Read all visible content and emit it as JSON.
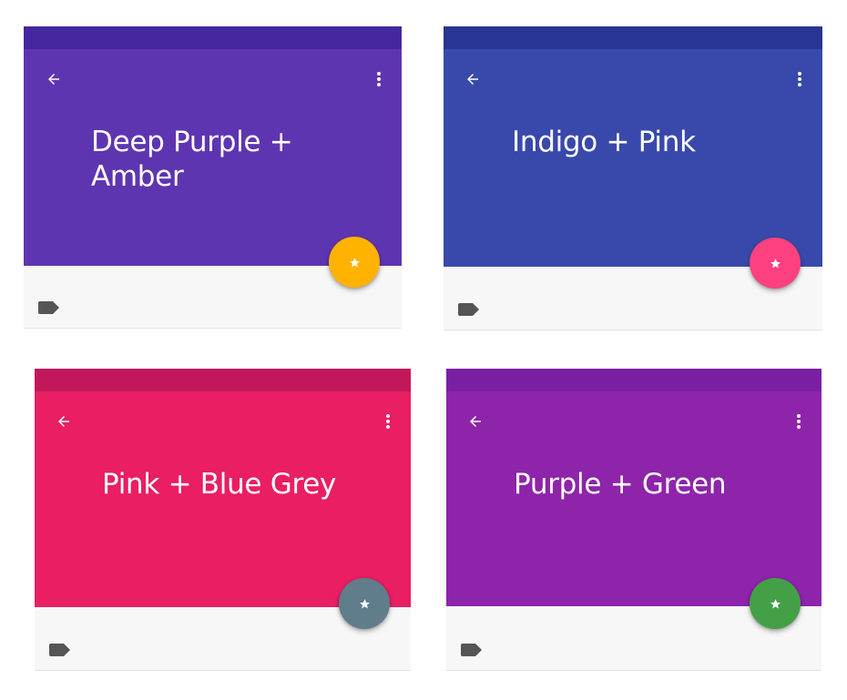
{
  "cards": [
    {
      "title": "Deep Purple +\nAmber",
      "primary_dark": "#4527a0",
      "primary": "#5e35b1",
      "accent": "#ffb300",
      "icons": {
        "back": "arrow-back-icon",
        "more": "more-vert-icon",
        "fab": "star-icon",
        "label": "label-tag-icon"
      }
    },
    {
      "title": "Indigo + Pink",
      "primary_dark": "#283593",
      "primary": "#3949ab",
      "accent": "#ff4081",
      "icons": {
        "back": "arrow-back-icon",
        "more": "more-vert-icon",
        "fab": "star-icon",
        "label": "label-tag-icon"
      }
    },
    {
      "title": "Pink + Blue Grey",
      "primary_dark": "#c2185b",
      "primary": "#e91e63",
      "accent": "#607d8b",
      "icons": {
        "back": "arrow-back-icon",
        "more": "more-vert-icon",
        "fab": "star-icon",
        "label": "label-tag-icon"
      }
    },
    {
      "title": "Purple + Green",
      "primary_dark": "#7b1fa2",
      "primary": "#8e24aa",
      "accent": "#43a047",
      "icons": {
        "back": "arrow-back-icon",
        "more": "more-vert-icon",
        "fab": "star-icon",
        "label": "label-tag-icon"
      }
    }
  ]
}
